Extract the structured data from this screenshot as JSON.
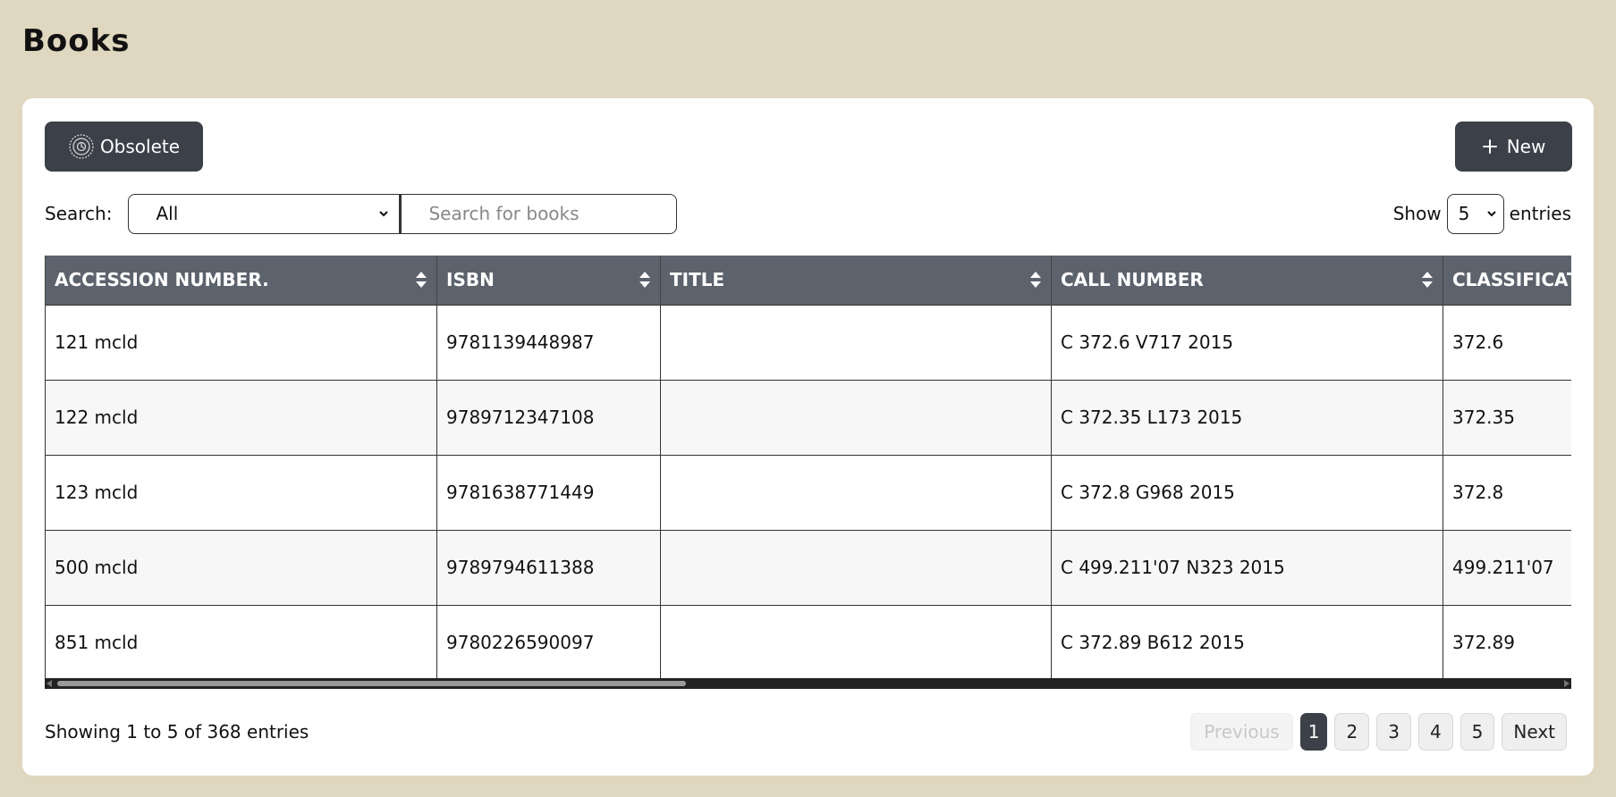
{
  "page": {
    "title": "Books"
  },
  "toolbar": {
    "obsolete_label": "Obsolete",
    "new_label": "New"
  },
  "search": {
    "label": "Search:",
    "field_value": "All",
    "placeholder": "Search for books"
  },
  "show": {
    "prefix": "Show",
    "value": "5",
    "suffix": "entries"
  },
  "table": {
    "columns": [
      "ACCESSION NUMBER.",
      "ISBN",
      "TITLE",
      "CALL NUMBER",
      "CLASSIFICATION"
    ],
    "rows": [
      [
        "121 mcld",
        "9781139448987",
        "",
        "C 372.6 V717 2015",
        "372.6"
      ],
      [
        "122 mcld",
        "9789712347108",
        "",
        "C 372.35 L173 2015",
        "372.35"
      ],
      [
        "123 mcld",
        "9781638771449",
        "",
        "C 372.8 G968 2015",
        "372.8"
      ],
      [
        "500 mcld",
        "9789794611388",
        "",
        "C 499.211'07 N323 2015",
        "499.211'07"
      ],
      [
        "851 mcld",
        "9780226590097",
        "",
        "C 372.89 B612 2015",
        "372.89"
      ]
    ]
  },
  "footer": {
    "info": "Showing 1 to 5 of 368 entries",
    "pagination": {
      "previous": "Previous",
      "pages": [
        "1",
        "2",
        "3",
        "4",
        "5"
      ],
      "current": "1",
      "next": "Next"
    }
  },
  "colors": {
    "background": "#dfd7bf",
    "button_dark": "#3b4049",
    "header_bg": "#5c636d"
  }
}
